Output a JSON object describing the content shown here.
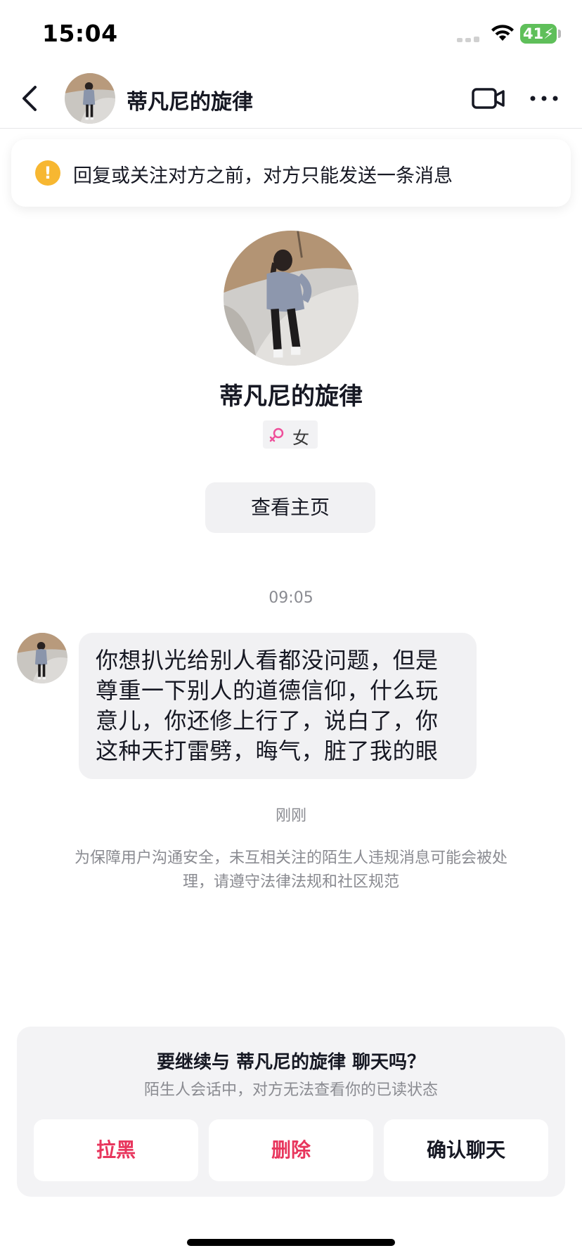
{
  "status_bar": {
    "time": "15:04",
    "battery": "41",
    "battery_color": "#5fbf5a",
    "icons": [
      "signal-icon",
      "wifi-icon",
      "battery-icon"
    ]
  },
  "header": {
    "back_icon": "chevron-left-icon",
    "title": "蒂凡尼的旋律",
    "video_icon": "video-camera-icon",
    "more_icon": "more-dots-icon"
  },
  "notice": {
    "icon": "warning-icon",
    "icon_color": "#f7b731",
    "text": "回复或关注对方之前，对方只能发送一条消息"
  },
  "profile": {
    "name": "蒂凡尼的旋律",
    "gender_icon": "female-icon",
    "gender_color": "#ee4f9a",
    "gender": "女",
    "view_profile_label": "查看主页"
  },
  "chat": {
    "time_label": "09:05",
    "message": "你想扒光给别人看都没问题，但是尊重一下别人的道德信仰，什么玩意儿，你还修上行了，说白了，你这种天打雷劈，晦气，脏了我的眼",
    "status_label": "刚刚",
    "safety_note": "为保障用户沟通安全，未互相关注的陌生人违规消息可能会被处理，请遵守法律法规和社区规范"
  },
  "stranger_panel": {
    "title": "要继续与 蒂凡尼的旋律 聊天吗？",
    "subtitle": "陌生人会话中，对方无法查看你的已读状态",
    "block_label": "拉黑",
    "delete_label": "删除",
    "confirm_label": "确认聊天",
    "danger_color": "#e8365d"
  }
}
